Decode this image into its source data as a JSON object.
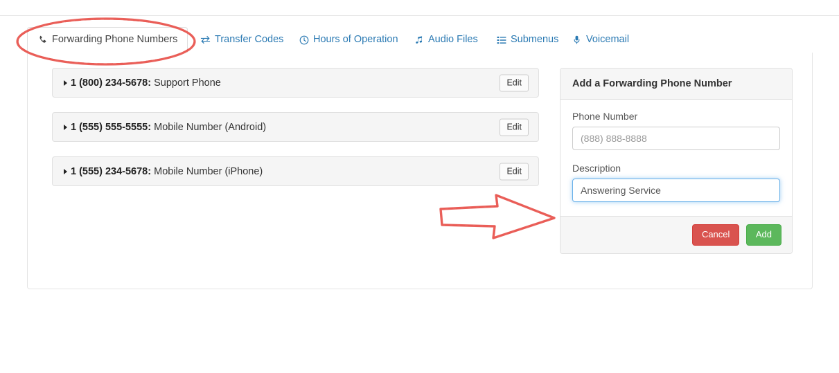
{
  "tabs": [
    {
      "label": "Forwarding Phone Numbers",
      "icon": "phone-icon",
      "active": true
    },
    {
      "label": "Transfer Codes",
      "icon": "exchange-icon",
      "active": false
    },
    {
      "label": "Hours of Operation",
      "icon": "clock-icon",
      "active": false
    },
    {
      "label": "Audio Files",
      "icon": "music-note-icon",
      "active": false
    },
    {
      "label": "Submenus",
      "icon": "list-icon",
      "active": false
    },
    {
      "label": "Voicemail",
      "icon": "microphone-icon",
      "active": false
    }
  ],
  "forwarding_numbers": [
    {
      "phone": "1 (800) 234-5678:",
      "description": "Support Phone",
      "edit_label": "Edit"
    },
    {
      "phone": "1 (555) 555-5555:",
      "description": "Mobile Number (Android)",
      "edit_label": "Edit"
    },
    {
      "phone": "1 (555) 234-5678:",
      "description": "Mobile Number (iPhone)",
      "edit_label": "Edit"
    }
  ],
  "add_panel": {
    "title": "Add a Forwarding Phone Number",
    "phone_label": "Phone Number",
    "phone_placeholder": "(888) 888-8888",
    "phone_value": "",
    "description_label": "Description",
    "description_value": "Answering Service",
    "cancel_label": "Cancel",
    "add_label": "Add"
  },
  "annotations": {
    "ellipse_target": "Forwarding Phone Numbers",
    "arrow_direction": "right",
    "color": "#e8554e"
  },
  "colors": {
    "tab_link": "#2b7ab3",
    "cancel_button": "#d9534f",
    "add_button": "#5cb85c",
    "focus_border": "#66afe9",
    "annotation_red": "#e8554e"
  }
}
